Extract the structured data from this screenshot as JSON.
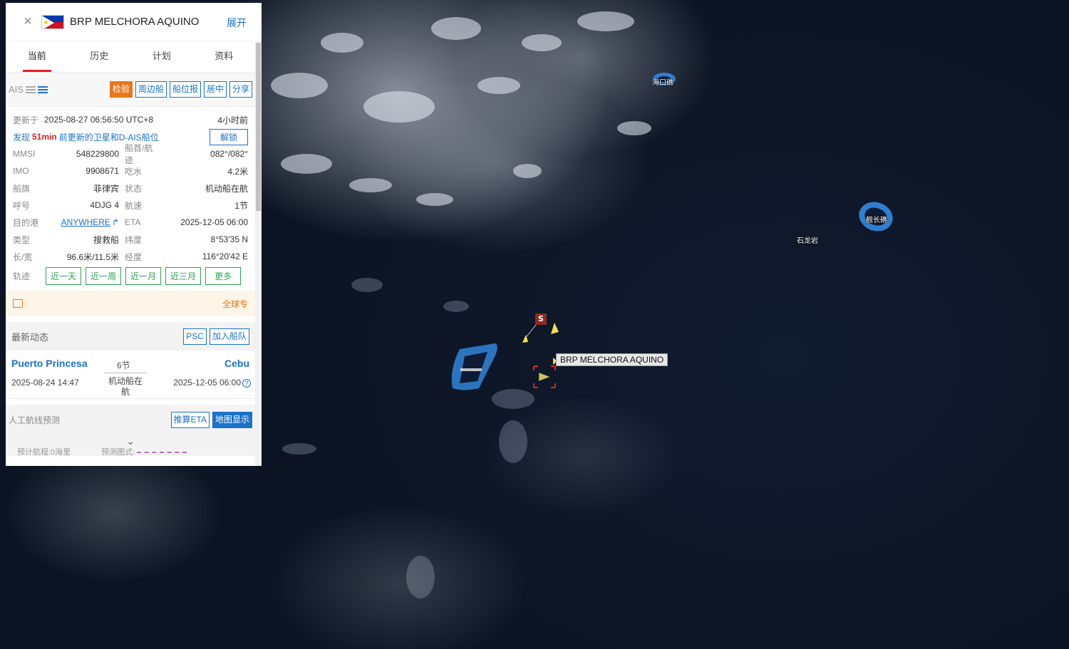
{
  "header": {
    "ship_name": "BRP MELCHORA AQUINO",
    "expand_label": "展开",
    "close_icon": "×"
  },
  "tabs": [
    {
      "label": "当前"
    },
    {
      "label": "历史"
    },
    {
      "label": "计划"
    },
    {
      "label": "资料"
    }
  ],
  "ais": {
    "label": "AIS",
    "actions": [
      "检验",
      "周边船",
      "船位报",
      "居中",
      "分享"
    ]
  },
  "update": {
    "label": "更新于",
    "time": "2025-08-27 06:56:50 UTC+8",
    "ago": "4小时前",
    "notice_prefix": "发现",
    "notice_minutes": "51min",
    "notice_suffix": "前更新的卫星和D-AIS船位",
    "unlock_label": "解锁"
  },
  "details": [
    {
      "k1": "MMSI",
      "v1": "548229800",
      "k2": "船首/航迹",
      "v2": "082°/082°"
    },
    {
      "k1": "IMO",
      "v1": "9908671",
      "k2": "吃水",
      "v2": "4.2米"
    },
    {
      "k1": "船旗",
      "v1": "菲律宾",
      "k2": "状态",
      "v2": "机动船在航"
    },
    {
      "k1": "呼号",
      "v1": "4DJG 4",
      "k2": "航速",
      "v2": "1节"
    },
    {
      "k1": "目的港",
      "v1": "ANYWHERE",
      "k2": "ETA",
      "v2": "2025-12-05 06:00"
    },
    {
      "k1": "类型",
      "v1": "搜救船",
      "k2": "纬度",
      "v2": "8°53'35 N"
    },
    {
      "k1": "长/宽",
      "v1": "96.6米/11.5米",
      "k2": "经度",
      "v2": "116°20'42 E"
    }
  ],
  "track": {
    "label": "轨迹",
    "buttons": [
      "近一天",
      "近一周",
      "近一月",
      "近三月",
      "更多"
    ]
  },
  "notice": {
    "text": "全球专"
  },
  "latest": {
    "title": "最新动态",
    "actions": [
      "PSC",
      "加入船队"
    ]
  },
  "voyage": {
    "departure_port": "Puerto Princesa",
    "arrival_port": "Cebu",
    "speed": "6节",
    "departure_time": "2025-08-24 14:47",
    "status": "机动船在航",
    "arrival_time": "2025-12-05 06:00",
    "help_icon": "?"
  },
  "prediction": {
    "title": "人工航线预测",
    "actions": [
      "推算ETA",
      "地图显示"
    ],
    "chevron": "⌄",
    "footer_left": "预计航程:0海里",
    "footer_right": "预测图式:"
  },
  "map": {
    "place_labels": [
      "海口礁",
      "舰长礁",
      "石龙岩"
    ],
    "ship_label": "BRP MELCHORA AQUINO",
    "marker_letter": "S",
    "colors": {
      "reef": "#2f7fd0",
      "ship_marker": "#e02020",
      "vessel": "#c8c45a",
      "buoy": "#f5e050"
    }
  },
  "colors": {
    "accent_blue": "#1a73c9",
    "tab_indicator": "#e02020",
    "check_button": "#e8761a",
    "track_green": "#2aa653"
  }
}
